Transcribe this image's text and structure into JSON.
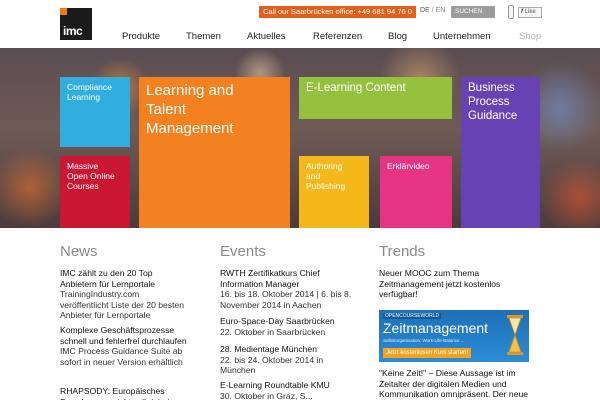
{
  "header": {
    "logo_text": "imc",
    "phone": "Call our Saarbrücken office: +49 681 94 76 0",
    "lang_de": "DE",
    "lang_sep": " / ",
    "lang_en": "EN",
    "search_label": "SUCHEN",
    "like_prefix": "f",
    "like_label": "Like"
  },
  "nav": [
    "Produkte",
    "Themen",
    "Aktuelles",
    "Referenzen",
    "Blog",
    "Unternehmen",
    "Shop"
  ],
  "tiles": {
    "compliance": [
      "Compliance",
      "Learning"
    ],
    "learning": [
      "Learning and",
      "Talent",
      "Management"
    ],
    "elearning": "E-Learning Content",
    "bpg": [
      "Business",
      "Process",
      "Guidance"
    ],
    "mooc": [
      "Massive",
      "Open Online",
      "Courses"
    ],
    "authoring": [
      "Authoring",
      "and",
      "Publishing"
    ],
    "erklaer": "Erklärvideo"
  },
  "colors": {
    "accent": "#f07d00",
    "compliance": "#31aedd",
    "learning": "#f4811f",
    "elearning": "#95c13f",
    "bpg": "#6742b3",
    "mooc": "#c91734",
    "authoring": "#f5b81a",
    "erklaer": "#e73384"
  },
  "news": {
    "heading": "News",
    "items": [
      {
        "title": "IMC zählt zu den 20 Top Anbietern für Lernportale",
        "text": "TrainingIndustry.com veröffentlicht Liste der 20 besten Anbieter für Lernportale"
      },
      {
        "title": "Komplexe Geschäftsprozesse schnell und fehlerfrei durchlaufen",
        "text": "IMC Process Guidance Suite ab sofort in neuer Version erhältlich"
      },
      {
        "title": "RHAPSODY: Europäisches Forschungsprojekt soll dabei",
        "text": ""
      }
    ]
  },
  "events": {
    "heading": "Events",
    "items": [
      {
        "title": "RWTH Zertifikatkurs Chief Information Manager",
        "text": "16. bis 18. Oktober 2014 | 6. bis 8. November 2014 in Aachen"
      },
      {
        "title": "Euro-Space-Day Saarbrücken",
        "text": "22. Oktober in Saarbrücken"
      },
      {
        "title": "28. Medientage München",
        "text": "22. bis 24. Oktober 2014 in München"
      },
      {
        "title": "E-Learning Roundtable KMU",
        "text": "30. Oktober in Graz, S..."
      }
    ]
  },
  "trends": {
    "heading": "Trends",
    "title": "Neuer MOOC zum Thema Zeitmanagement jetzt kostenlos verfügbar!",
    "banner_brand": "OPENCOURSEWORLD",
    "banner_title": "Zeitmanagement",
    "banner_tagline": "Selbstorganisation, Work-Life-Balance ...",
    "banner_cta": "Jetzt kostenlosen Kurs starten!",
    "quote": "\"Keine Zeit!\" – Diese Aussage ist im Zeitalter der digitalen Medien und Kommunikation omnipräsent. Der neue Zeitmanagement-Kurs"
  }
}
